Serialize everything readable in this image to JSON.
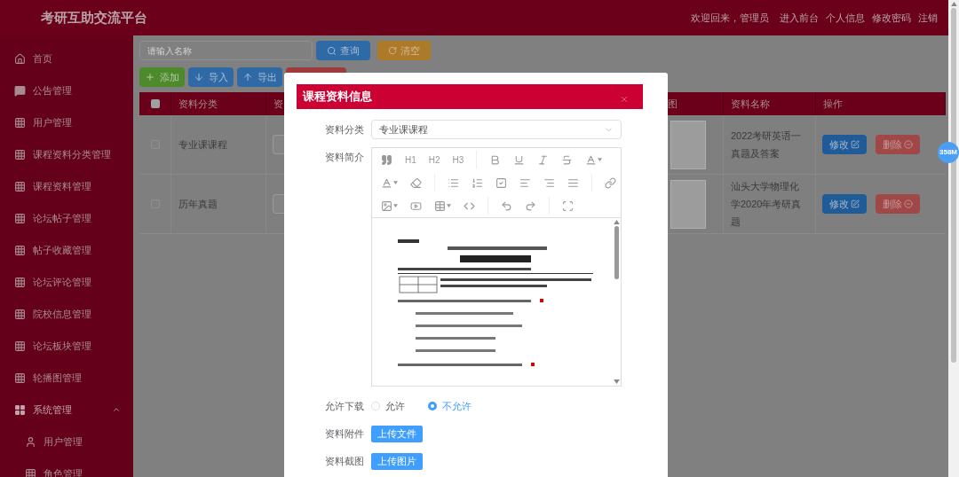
{
  "header": {
    "title": "考研互助交流平台",
    "links": [
      "欢迎回来，管理员",
      "进入前台",
      "个人信息",
      "修改密码",
      "注销"
    ]
  },
  "sidebar": {
    "items": [
      {
        "label": "首页",
        "kind": "home"
      },
      {
        "label": "公告管理",
        "kind": "notice"
      },
      {
        "label": "用户管理",
        "kind": "grid"
      },
      {
        "label": "课程资料分类管理",
        "kind": "grid"
      },
      {
        "label": "课程资料管理",
        "kind": "grid"
      },
      {
        "label": "论坛帖子管理",
        "kind": "grid"
      },
      {
        "label": "帖子收藏管理",
        "kind": "grid"
      },
      {
        "label": "论坛评论管理",
        "kind": "grid"
      },
      {
        "label": "院校信息管理",
        "kind": "grid"
      },
      {
        "label": "论坛板块管理",
        "kind": "grid"
      },
      {
        "label": "轮播图管理",
        "kind": "grid"
      },
      {
        "label": "系统管理",
        "kind": "group",
        "expanded": true,
        "children": [
          {
            "label": "用户管理",
            "kind": "user"
          },
          {
            "label": "角色管理",
            "kind": "grid"
          }
        ]
      }
    ]
  },
  "search": {
    "placeholder": "请输入名称",
    "buttons": [
      {
        "label": "查询",
        "kind": "search"
      },
      {
        "label": "清空",
        "kind": "reset"
      }
    ]
  },
  "actions": [
    {
      "label": "添加",
      "kind": "add"
    },
    {
      "label": "导入",
      "kind": "import"
    },
    {
      "label": "导出",
      "kind": "export"
    },
    {
      "kind": "delete"
    }
  ],
  "table": {
    "select_all_checked": false,
    "columns": [
      "资料分类",
      "资",
      "图",
      "资料名称",
      "操作"
    ],
    "rows": [
      {
        "checked": false,
        "category": "专业课课程",
        "name": "2022考研英语一真题及答案",
        "edit": "修改",
        "delete": "删除"
      },
      {
        "checked": false,
        "category": "历年真题",
        "name": "汕头大学物理化学2020年考研真题",
        "edit": "修改",
        "delete": "删除"
      }
    ]
  },
  "dialog": {
    "title": "课程资料信息",
    "category": {
      "label": "资料分类",
      "value": "专业课课程"
    },
    "intro": {
      "label": "资料简介",
      "headings": [
        "H1",
        "H2",
        "H3"
      ]
    },
    "download": {
      "label": "允许下载",
      "options": [
        {
          "label": "允许",
          "selected": false
        },
        {
          "label": "不允许",
          "selected": true
        }
      ]
    },
    "attachment": {
      "label": "资料附件",
      "button": "上传文件"
    },
    "screenshot": {
      "label": "资料截图",
      "button": "上传图片"
    }
  },
  "memory_badge": "358M"
}
